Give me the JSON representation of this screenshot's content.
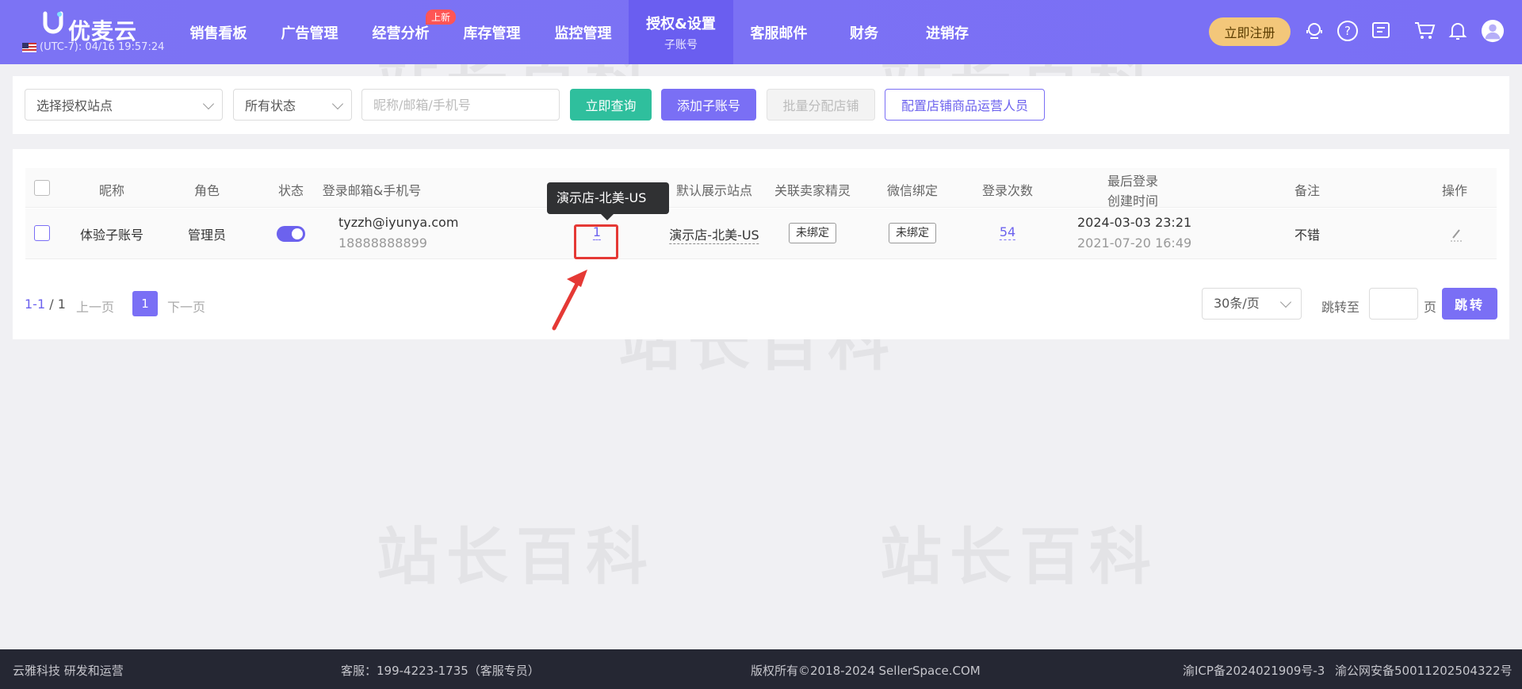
{
  "header": {
    "logo_text": "优麦云",
    "timezone_time": "(UTC-7): 04/16 19:57:24",
    "nav": [
      {
        "label": "销售看板"
      },
      {
        "label": "广告管理"
      },
      {
        "label": "经营分析",
        "badge": "上新"
      },
      {
        "label": "库存管理"
      },
      {
        "label": "监控管理"
      },
      {
        "label": "授权&设置",
        "sub": "子账号",
        "active": true
      },
      {
        "label": "客服邮件"
      },
      {
        "label": "财务"
      },
      {
        "label": "进销存"
      }
    ],
    "register_label": "立即注册"
  },
  "filter": {
    "site_select": "选择授权站点",
    "status_select": "所有状态",
    "search_placeholder": "昵称/邮箱/手机号",
    "query_label": "立即查询",
    "add_label": "添加子账号",
    "batch_label": "批量分配店铺",
    "config_label": "配置店铺商品运营人员"
  },
  "table": {
    "headers": {
      "nickname": "昵称",
      "role": "角色",
      "status": "状态",
      "login": "登录邮箱&手机号",
      "default_site": "默认展示站点",
      "linked": "关联卖家精灵",
      "wechat": "微信绑定",
      "login_count": "登录次数",
      "last_login": "最后登录",
      "created": "创建时间",
      "remark": "备注",
      "action": "操作"
    },
    "rows": [
      {
        "nickname": "体验子账号",
        "role": "管理员",
        "email": "tyzzh@iyunya.com",
        "phone": "18888888899",
        "auth_store_count": "1",
        "default_site": "演示店-北美-US",
        "linked": "未绑定",
        "wechat": "未绑定",
        "login_count": "54",
        "last_login": "2024-03-03 23:21",
        "created": "2021-07-20 16:49",
        "remark": "不错"
      }
    ]
  },
  "tooltip": "演示店-北美-US",
  "pagination": {
    "range": "1-1",
    "total": "/ 1",
    "prev": "上一页",
    "current": "1",
    "next": "下一页",
    "per_page": "30条/页",
    "jump_to": "跳转至",
    "page_unit": "页",
    "jump_btn": "跳转"
  },
  "watermark": "站长百科",
  "footer": {
    "company": "云雅科技 研发和运营",
    "service": "客服：199-4223-1735（客服专员）",
    "copyright": "版权所有©2018-2024 SellerSpace.COM",
    "icp": "渝ICP备2024021909号-3",
    "police": "渝公网安备50011202504322号"
  },
  "colors": {
    "primary": "#7a6ff5",
    "query": "#2fbf9d",
    "register": "#f3c77a",
    "highlight": "#e53935"
  }
}
